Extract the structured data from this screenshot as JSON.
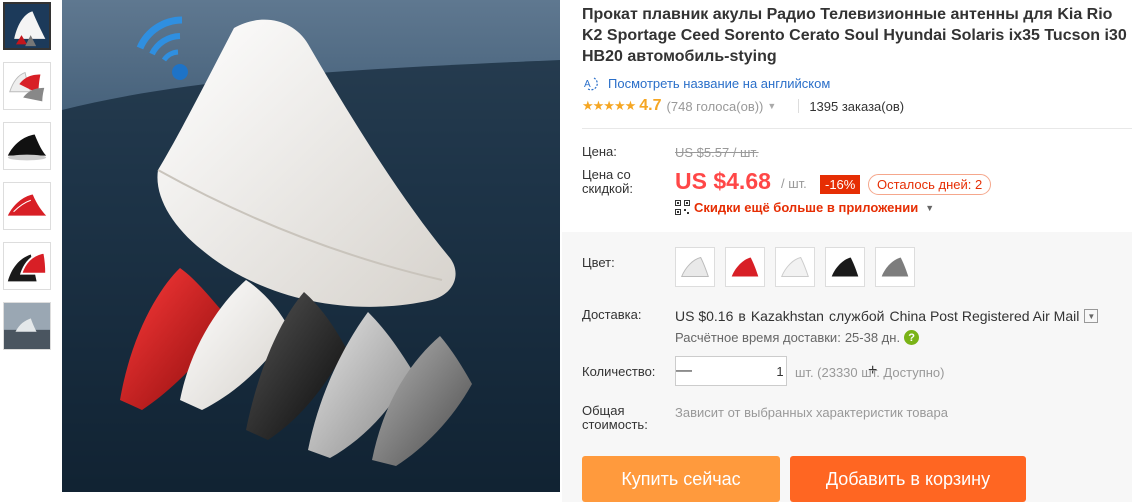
{
  "product": {
    "title": "Прокат плавник акулы Радио Телевизионные антенны для Kia Rio K2 Sportage Ceed Sorento Cerato Soul Hyundai Solaris ix35 Tucson i30 HB20 автомобиль-stying",
    "translate_link": "Посмотреть название на английском",
    "rating": "4.7",
    "stars": "★★★★★",
    "votes": "(748 голоса(ов))",
    "orders": "1395 заказа(ов)"
  },
  "price": {
    "label_price": "Цена:",
    "old_price": "US $5.57 / шт.",
    "label_discount_price": "Цена со скидкой:",
    "current_price": "US $4.68",
    "per_unit": "/ шт.",
    "discount": "-16%",
    "days_left": "Осталось дней: 2",
    "app_discount": "Скидки ещё больше в приложении"
  },
  "options": {
    "color_label": "Цвет:",
    "swatch_colors": [
      "#e9e9e9",
      "#d81f26",
      "#f2f2f2",
      "#1a1a1a",
      "#7d7d7d"
    ]
  },
  "shipping": {
    "label": "Доставка:",
    "cost": "US $0.16",
    "to_prefix": "в",
    "country": "Kazakhstan",
    "service_prefix": "службой",
    "service": "China Post Registered Air Mail",
    "time_label": "Расчётное время доставки:",
    "time_value": "25-38 дн."
  },
  "quantity": {
    "label": "Количество:",
    "value": "1",
    "availability": "шт. (23330 шт. Доступно)"
  },
  "total": {
    "label": "Общая стоимость:",
    "value": "Зависит от выбранных характеристик товара"
  },
  "actions": {
    "buy_now": "Купить сейчас",
    "add_to_cart": "Добавить в корзину"
  },
  "colors": {
    "accent": "#ff4747",
    "buy": "#ff9a3d",
    "cart": "#ff6622",
    "link": "#2a6fc9",
    "rating": "#f5a623"
  }
}
